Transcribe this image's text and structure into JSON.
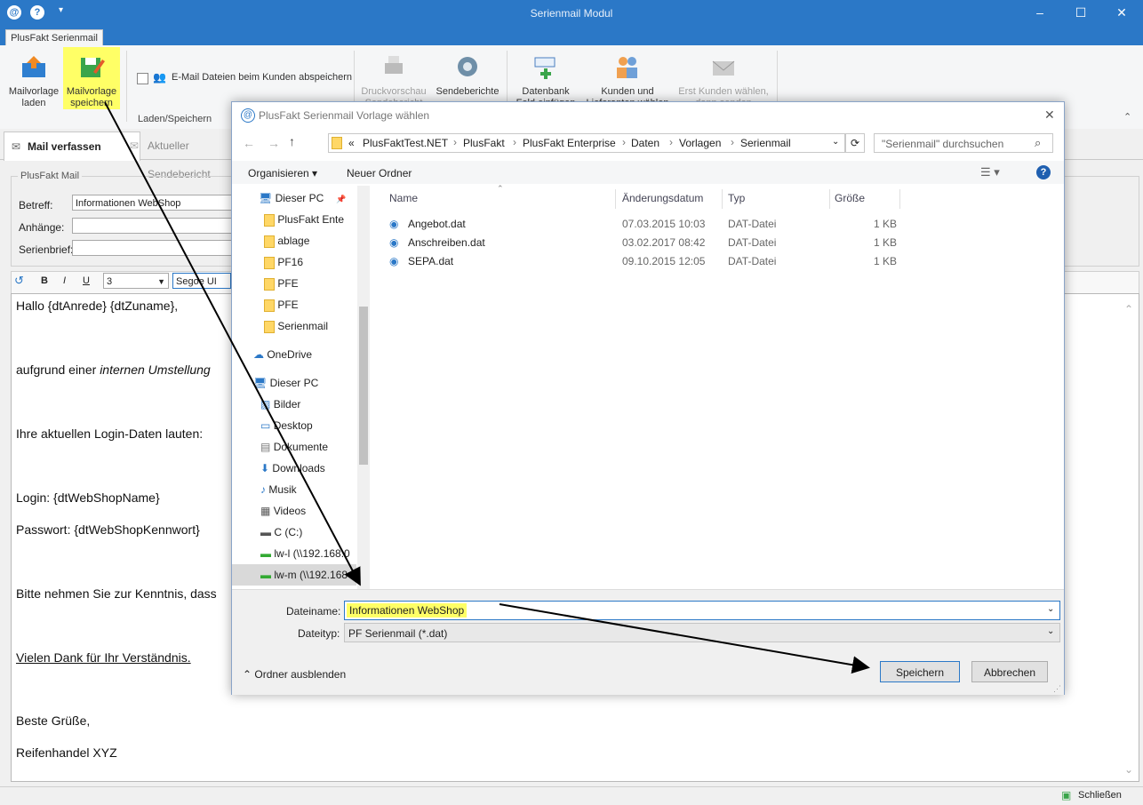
{
  "window": {
    "title": "Serienmail Modul"
  },
  "ribbon": {
    "tab": "PlusFakt Serienmail",
    "buttons": {
      "load": "Mailvorlage laden",
      "save": "Mailvorlage speichern",
      "save_checkbox": "E-Mail Dateien beim Kunden abspeichern",
      "group_label": "Laden/Speichern",
      "preview": "Druckvorschau Sendebericht",
      "reports": "Sendeberichte",
      "db_field": "Datenbank Feld einfügen",
      "customers": "Kunden und Lieferanten wählen",
      "first_select": "Erst Kunden wählen, dann senden"
    }
  },
  "main": {
    "tabs": [
      "Mail verfassen",
      "Aktueller Sendebericht"
    ],
    "group": "PlusFakt Mail",
    "fields": {
      "subject_label": "Betreff:",
      "subject_value": "Informationen WebShop",
      "attachments_label": "Anhänge:",
      "letter_label": "Serienbrief:"
    },
    "format": {
      "size": "3",
      "font": "Segoe UI"
    },
    "editor_lines": {
      "l1": "Hallo {dtAnrede} {dtZuname},",
      "l2a": "aufgrund einer ",
      "l2b": "internen Umstellung",
      "l3": "Ihre aktuellen Login-Daten lauten:",
      "l4": "Login: {dtWebShopName}",
      "l5": "Passwort: {dtWebShopKennwort}",
      "l6": "Bitte nehmen Sie zur Kenntnis, dass",
      "l7": "Vielen Dank für Ihr Verständnis.",
      "l8": "Beste Grüße,",
      "l9": "Reifenhandel XYZ"
    },
    "status_close": "Schließen"
  },
  "dialog": {
    "title": "PlusFakt Serienmail Vorlage wählen",
    "breadcrumb": [
      "PlusFaktTest.NET",
      "PlusFakt",
      "PlusFakt Enterprise",
      "Daten",
      "Vorlagen",
      "Serienmail"
    ],
    "search_placeholder": "\"Serienmail\" durchsuchen",
    "toolbar": {
      "organize": "Organisieren",
      "new_folder": "Neuer Ordner"
    },
    "tree": [
      "Dieser PC",
      "PlusFakt Ente",
      "ablage",
      "PF16",
      "PFE",
      "PFE",
      "Serienmail",
      "OneDrive",
      "Dieser PC",
      "Bilder",
      "Desktop",
      "Dokumente",
      "Downloads",
      "Musik",
      "Videos",
      "C (C:)",
      "lw-l (\\\\192.168.0",
      "lw-m (\\\\192.168"
    ],
    "columns": [
      "Name",
      "Änderungsdatum",
      "Typ",
      "Größe"
    ],
    "files": [
      {
        "name": "Angebot.dat",
        "date": "07.03.2015 10:03",
        "type": "DAT-Datei",
        "size": "1 KB"
      },
      {
        "name": "Anschreiben.dat",
        "date": "03.02.2017 08:42",
        "type": "DAT-Datei",
        "size": "1 KB"
      },
      {
        "name": "SEPA.dat",
        "date": "09.10.2015 12:05",
        "type": "DAT-Datei",
        "size": "1 KB"
      }
    ],
    "filename_label": "Dateiname:",
    "filename_value": "Informationen WebShop",
    "filetype_label": "Dateityp:",
    "filetype_value": "PF Serienmail  (*.dat)",
    "hide_folders": "Ordner ausblenden",
    "save": "Speichern",
    "cancel": "Abbrechen"
  },
  "colors": {
    "accent": "#2b78c7",
    "highlight": "#ffff66"
  }
}
